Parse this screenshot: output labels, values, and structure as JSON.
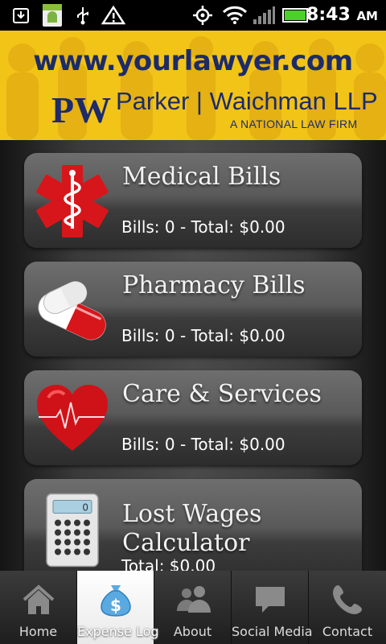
{
  "status_bar": {
    "time": "8:43",
    "ampm": "AM"
  },
  "banner": {
    "url": "www.yourlawyer.com",
    "logo_initials": "PW",
    "firm_name": "Parker | Waichman LLP",
    "tagline": "A NATIONAL LAW FIRM"
  },
  "categories": [
    {
      "title": "Medical Bills",
      "summary": "Bills: 0 - Total: $0.00",
      "icon": "medical-star-of-life-icon"
    },
    {
      "title": "Pharmacy Bills",
      "summary": "Bills: 0 - Total: $0.00",
      "icon": "pill-capsule-icon"
    },
    {
      "title": "Care & Services",
      "summary": "Bills: 0 - Total: $0.00",
      "icon": "heart-icon"
    },
    {
      "title_line1": "Lost Wages",
      "title_line2": "Calculator",
      "summary": "Total: $0.00",
      "icon": "calculator-icon"
    }
  ],
  "tabs": [
    {
      "label": "Home",
      "icon": "home-icon"
    },
    {
      "label": "Expense Log",
      "icon": "money-bag-icon",
      "active": true
    },
    {
      "label": "About",
      "icon": "people-icon"
    },
    {
      "label": "Social Media",
      "icon": "speech-bubble-icon"
    },
    {
      "label": "Contact",
      "icon": "phone-icon"
    }
  ],
  "colors": {
    "banner_bg": "#f2c418",
    "brand_navy": "#1d2b6b",
    "card_top": "#6e6e6e",
    "card_bottom": "#2c2c2c"
  }
}
